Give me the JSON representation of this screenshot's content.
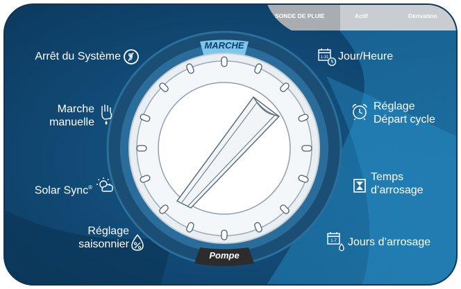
{
  "rain_sensor": {
    "label": "SONDE DE PLUIE",
    "active": "Actif",
    "bypass": "Dérivation"
  },
  "dial": {
    "top_label": "MARCHE",
    "bottom_label": "Pompe"
  },
  "left_positions": {
    "system_off": "Arrêt du Système",
    "manual_line1": "Marche",
    "manual_line2": "manuelle",
    "solar_sync": "Solar Sync",
    "solar_sync_mark": "®",
    "seasonal_line1": "Réglage",
    "seasonal_line2": "saisonnier"
  },
  "right_positions": {
    "date_time": "Jour/Heure",
    "start_line1": "Réglage",
    "start_line2": "Départ cycle",
    "run_line1": "Temps",
    "run_line2": "d’arrosage",
    "water_days": "Jours d’arrosage"
  },
  "icons": {
    "date_time_badge": "1-31",
    "water_days_badge": "1-7"
  },
  "colors": {
    "panel_dark": "#0c3d63",
    "panel_mid": "#13578a",
    "accent_light": "#1d87c4",
    "marche_band": "#7ec6ec",
    "pompe_band": "#2c2c2c",
    "dial_ring": "#1d5a84"
  }
}
